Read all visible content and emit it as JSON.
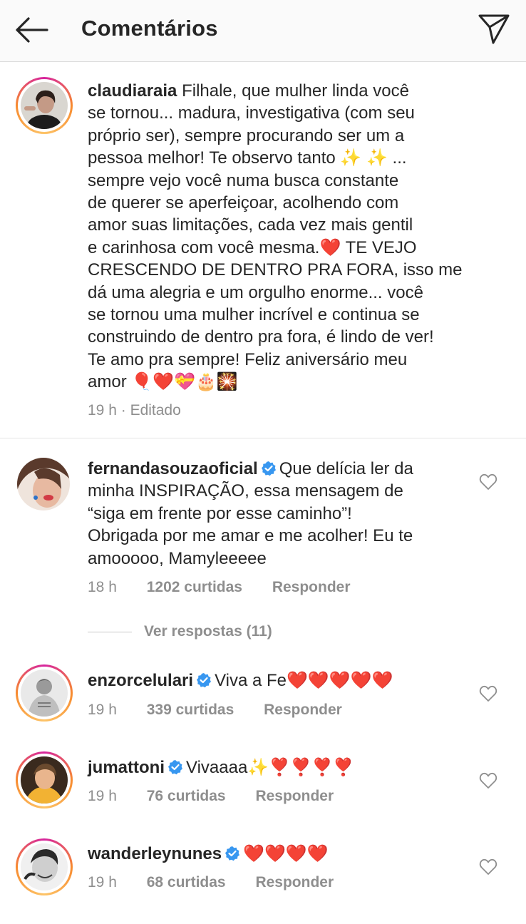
{
  "header": {
    "title": "Comentários"
  },
  "caption": {
    "username": "claudiaraia",
    "lines": [
      "Filhale, que mulher linda você",
      "se tornou... madura, investigativa (com seu",
      "próprio ser), sempre procurando ser um a",
      "pessoa melhor! Te observo tanto ✨ ✨ ...",
      "sempre vejo você numa busca constante",
      "de querer se aperfeiçoar, acolhendo com",
      "amor suas limitações, cada vez mais gentil",
      "e carinhosa com você mesma.❤️ TE VEJO",
      "CRESCENDO DE DENTRO PRA FORA, isso me",
      "dá uma alegria e um orgulho enorme... você",
      "se tornou uma mulher incrível e continua se",
      "construindo de dentro pra fora, é lindo de ver!",
      "Te amo pra sempre! Feliz aniversário meu",
      "amor 🎈❤️💝🎂🎇"
    ],
    "time": "19 h",
    "edited": "Editado"
  },
  "comments": [
    {
      "username": "fernandasouzaoficial",
      "lines": [
        "Que delícia ler da",
        "minha INSPIRAÇÃO, essa mensagem de",
        "“siga em frente por esse caminho”!",
        "Obrigada por me amar e me acolher! Eu te",
        "amooooo, Mamyleeeee"
      ],
      "time": "18 h",
      "likes": "1202 curtidas",
      "reply": "Responder"
    },
    {
      "username": "enzorcelulari",
      "text": "Viva a Fe❤️❤️❤️❤️❤️",
      "time": "19 h",
      "likes": "339 curtidas",
      "reply": "Responder"
    },
    {
      "username": "jumattoni",
      "text": "Vivaaaa✨❣️❣️❣️❣️",
      "time": "19 h",
      "likes": "76 curtidas",
      "reply": "Responder"
    },
    {
      "username": "wanderleynunes",
      "text": "❤️❤️❤️❤️",
      "time": "19 h",
      "likes": "68 curtidas",
      "reply": "Responder"
    }
  ],
  "view_replies": "Ver respostas (11)",
  "icons": {
    "back": "back-arrow-icon",
    "send": "paper-plane-icon",
    "like": "heart-outline-icon",
    "verified": "verified-badge-icon"
  },
  "colors": {
    "verified_blue": "#3897f0",
    "meta_gray": "#8e8e8e",
    "heart_red": "#e0192a"
  }
}
